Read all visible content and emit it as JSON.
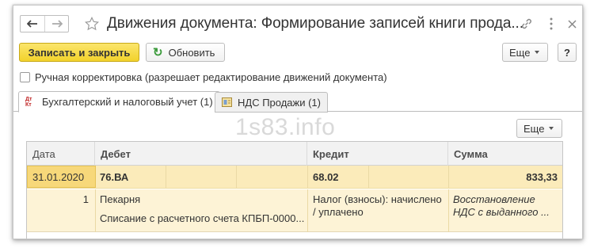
{
  "window": {
    "title": "Движения документа: Формирование записей книги прода...",
    "nav_back_icon": "arrow-left-icon",
    "nav_forward_icon": "arrow-right-icon",
    "favorite_icon": "star-icon",
    "link_icon": "link-icon",
    "menu_icon": "more-vertical-icon",
    "close_icon": "close-icon"
  },
  "toolbar": {
    "save_close_label": "Записать и закрыть",
    "refresh_label": "Обновить",
    "more_label": "Еще",
    "help_label": "?"
  },
  "manual_correction": {
    "label": "Ручная корректировка (разрешает редактирование движений документа)",
    "checked": false
  },
  "tabs": [
    {
      "label": "Бухгалтерский и налоговый учет (1)",
      "icon": "dt-kt-icon",
      "icon_text_top": "Дт",
      "icon_text_bottom": "Кт",
      "active": true
    },
    {
      "label": "НДС Продажи (1)",
      "icon": "register-icon",
      "active": false
    }
  ],
  "watermark": "1s83.info",
  "table": {
    "more_label": "Еще",
    "columns": [
      "Дата",
      "Дебет",
      "Кредит",
      "Сумма"
    ],
    "rows": [
      {
        "date": "31.01.2020",
        "debit_account": "76.ВА",
        "credit_account": "68.02",
        "amount": "833,33",
        "number": "1",
        "debit_subconto1": "Пекарня",
        "debit_subconto2": "Списание с расчетного счета КПБП-0000...",
        "credit_subconto1": "Налог (взносы): начислено",
        "credit_subconto2": "/ уплачено",
        "content_line1": "Восстановление",
        "content_line2": "НДС с выданного ..."
      }
    ]
  },
  "colors": {
    "primary_button": "#f2d22b",
    "selected_row": "#fbebba",
    "row_detail": "#fdf3d6",
    "selected_cell": "#f7d87a",
    "refresh_icon": "#3c9b3c"
  }
}
